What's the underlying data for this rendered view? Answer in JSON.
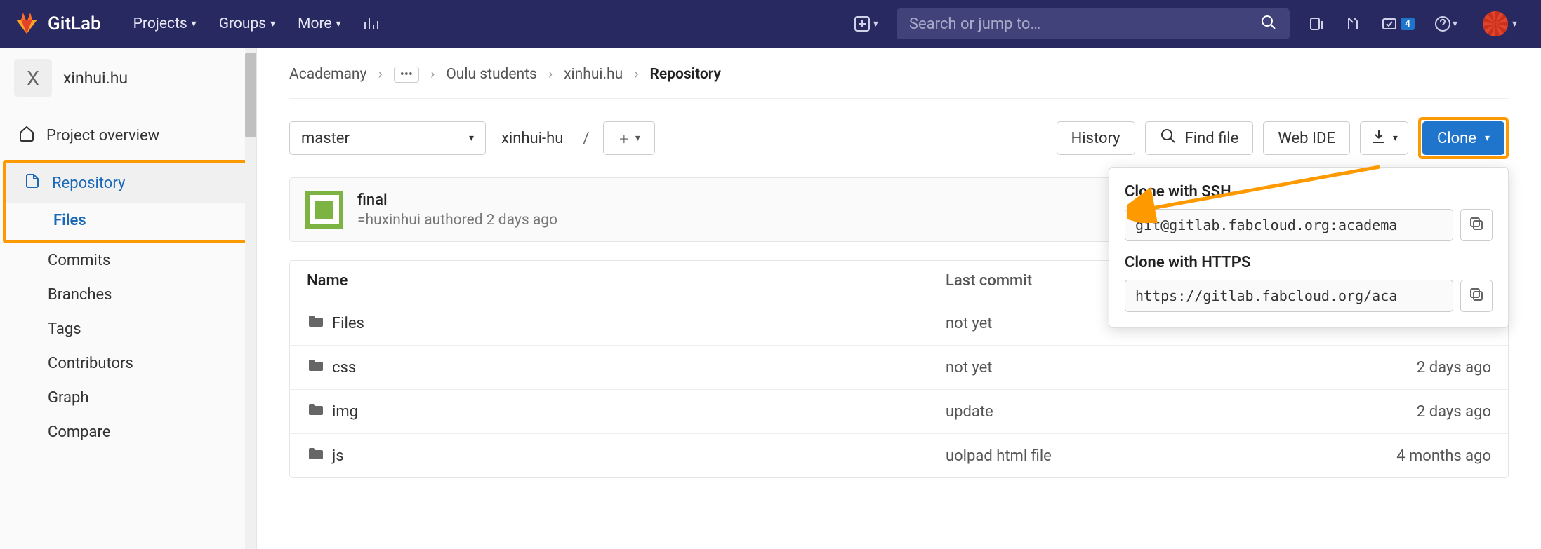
{
  "header": {
    "brand": "GitLab",
    "nav": {
      "projects": "Projects",
      "groups": "Groups",
      "more": "More"
    },
    "search_placeholder": "Search or jump to…",
    "todo_count": "4"
  },
  "sidebar": {
    "project_letter": "X",
    "project_name": "xinhui.hu",
    "overview": "Project overview",
    "repository": "Repository",
    "sub": {
      "files": "Files",
      "commits": "Commits",
      "branches": "Branches",
      "tags": "Tags",
      "contributors": "Contributors",
      "graph": "Graph",
      "compare": "Compare"
    }
  },
  "breadcrumbs": {
    "root": "Academany",
    "g1": "Oulu students",
    "g2": "xinhui.hu",
    "current": "Repository"
  },
  "toolbar": {
    "branch": "master",
    "path": "xinhui-hu",
    "history": "History",
    "find_file": "Find file",
    "web_ide": "Web IDE",
    "clone": "Clone"
  },
  "commit": {
    "title": "final",
    "meta": "=huxinhui authored 2 days ago"
  },
  "table": {
    "h_name": "Name",
    "h_commit": "Last commit",
    "rows": [
      {
        "name": "Files",
        "commit": "not yet",
        "time": ""
      },
      {
        "name": "css",
        "commit": "not yet",
        "time": "2 days ago"
      },
      {
        "name": "img",
        "commit": "update",
        "time": "2 days ago"
      },
      {
        "name": "js",
        "commit": "uolpad html file",
        "time": "4 months ago"
      }
    ]
  },
  "clone_dropdown": {
    "ssh_label": "Clone with SSH",
    "ssh_url": "git@gitlab.fabcloud.org:academa",
    "https_label": "Clone with HTTPS",
    "https_url": "https://gitlab.fabcloud.org/aca"
  }
}
